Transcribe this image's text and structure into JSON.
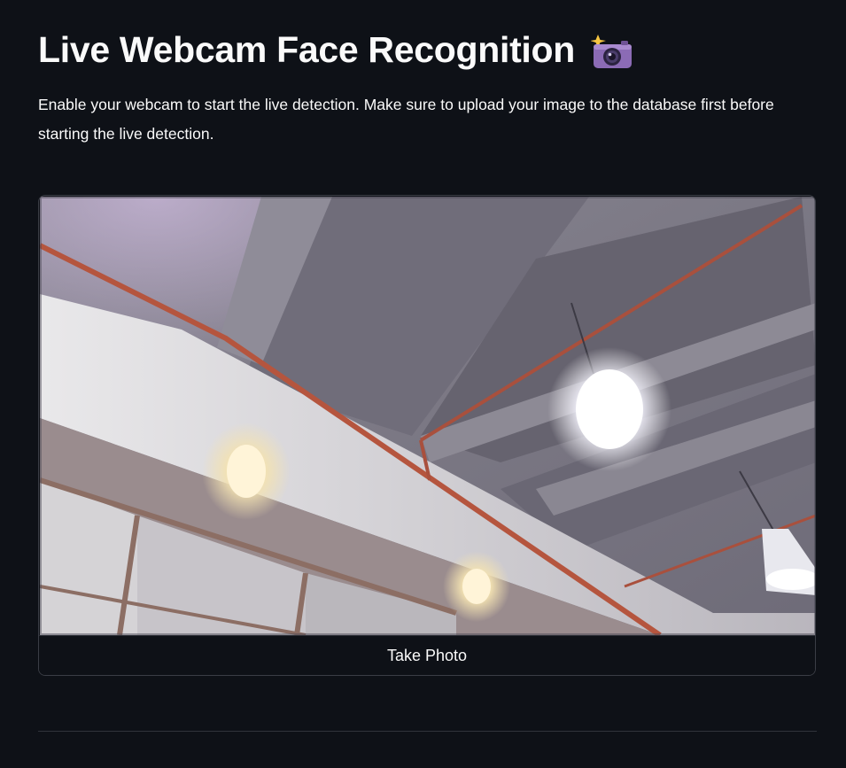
{
  "header": {
    "title": "Live Webcam Face Recognition",
    "title_icon": "camera-with-flash-icon"
  },
  "description": "Enable your webcam to start the live detection. Make sure to upload your image to the database first before starting the live detection.",
  "camera": {
    "feed_content": "webcam-live-feed",
    "take_photo_label": "Take Photo"
  },
  "colors": {
    "background": "#0e1117",
    "text": "#fafafa",
    "border": "#3a3d45",
    "pipe": "#b5553e"
  }
}
